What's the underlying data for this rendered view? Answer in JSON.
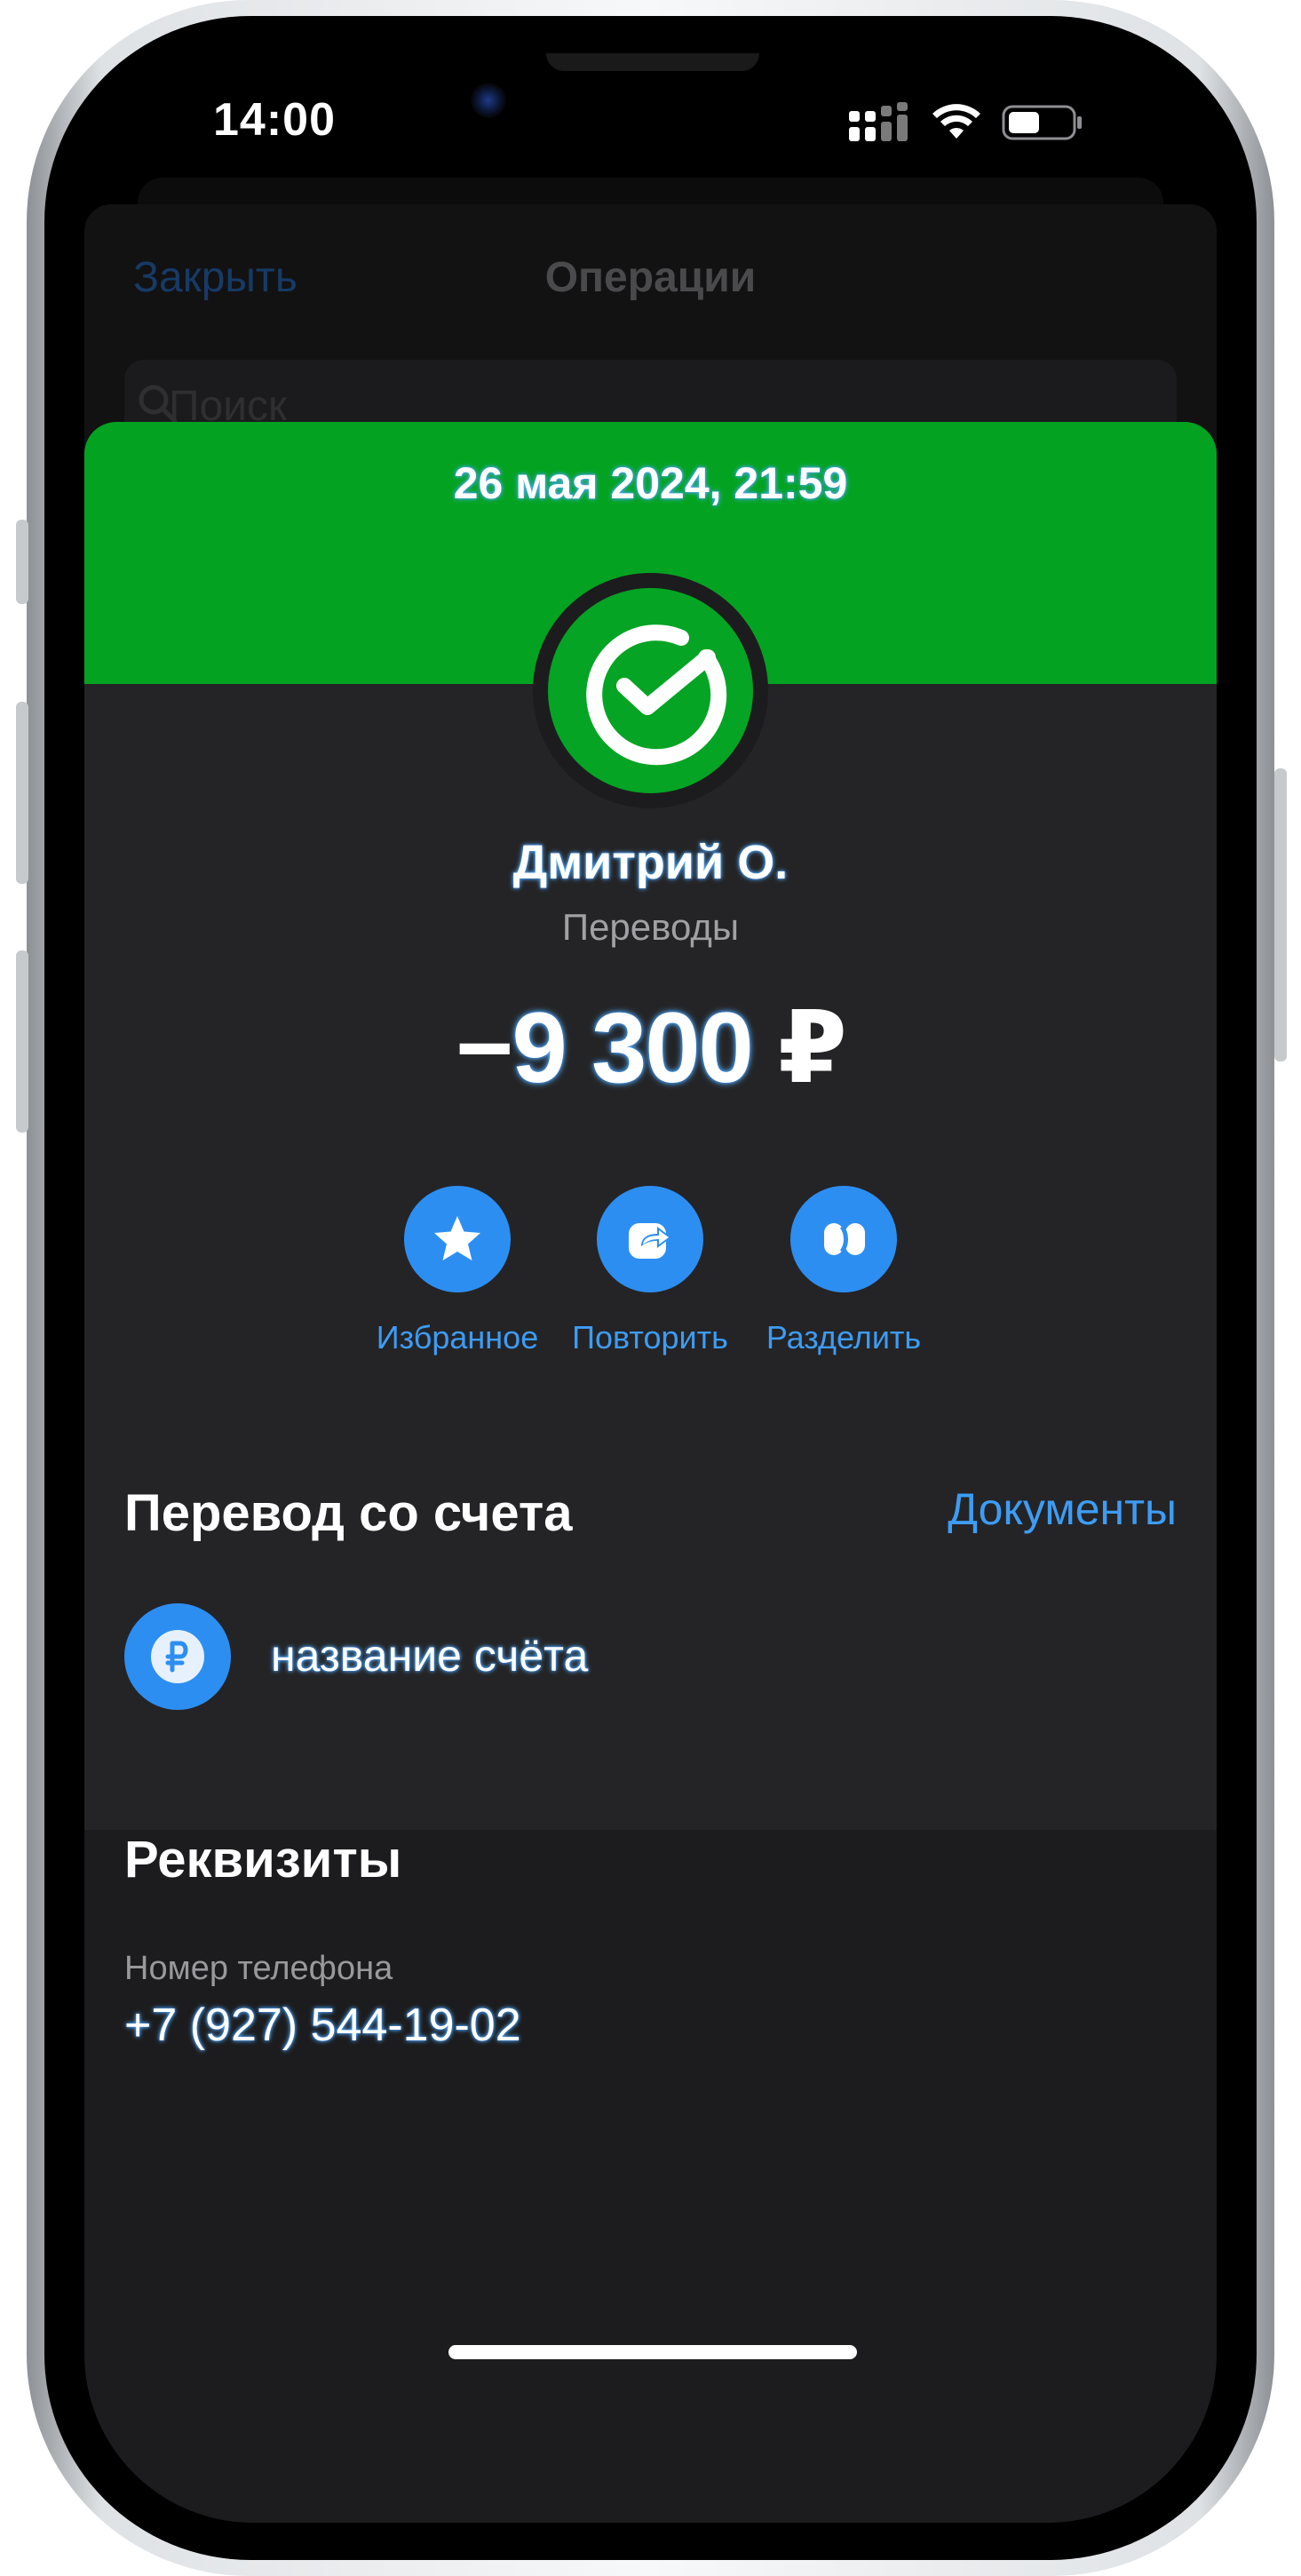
{
  "status_bar": {
    "time": "14:00"
  },
  "background_screen": {
    "close_label": "Закрыть",
    "title": "Операции",
    "search_placeholder": "Поиск"
  },
  "operation": {
    "datetime": "26 мая 2024, 21:59",
    "recipient": "Дмитрий О.",
    "category": "Переводы",
    "amount_sign": "−",
    "amount_value": "9 300",
    "currency": "₽"
  },
  "actions": [
    {
      "label": "Избранное",
      "icon": "star-icon"
    },
    {
      "label": "Повторить",
      "icon": "repeat-arrow-icon"
    },
    {
      "label": "Разделить",
      "icon": "split-icon"
    }
  ],
  "source_section": {
    "title": "Перевод со счета",
    "documents_link": "Документы",
    "account_name": "название счёта",
    "account_icon": "ruble-icon"
  },
  "requisites_section": {
    "title": "Реквизиты",
    "phone_label": "Номер телефона",
    "phone_value": "+7 (927) 544-19-02"
  },
  "colors": {
    "brand_green": "#03a321",
    "accent_blue": "#2d8ef2",
    "link_blue": "#3d9cf5",
    "card_dark": "#242426",
    "background_dark": "#1c1c1e"
  }
}
